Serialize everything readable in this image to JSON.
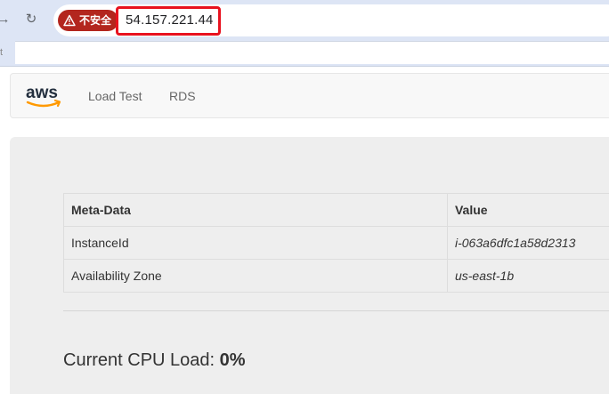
{
  "browser": {
    "security_chip_label": "不安全",
    "address": "54.157.221.44",
    "bookmark_glyph": "t"
  },
  "navbar": {
    "logo_text": "aws",
    "links": [
      {
        "label": "Load Test"
      },
      {
        "label": "RDS"
      }
    ]
  },
  "meta_table": {
    "headers": [
      "Meta-Data",
      "Value"
    ],
    "rows": [
      {
        "key": "InstanceId",
        "value": "i-063a6dfc1a58d2313"
      },
      {
        "key": "Availability Zone",
        "value": "us-east-1b"
      }
    ]
  },
  "cpu": {
    "label": "Current CPU Load:",
    "value": "0%"
  },
  "colors": {
    "chip_red": "#b3261e",
    "highlight_red": "#e8121f",
    "aws_orange": "#ff9900",
    "aws_text": "#232f3e"
  }
}
